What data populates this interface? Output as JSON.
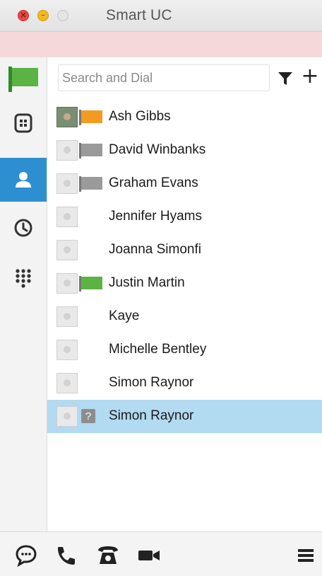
{
  "window": {
    "title": "Smart UC",
    "close_glyph": "×",
    "minimize_glyph": "–"
  },
  "presence": {
    "status_color": "#5bb344",
    "icon": "flag-icon"
  },
  "rail": {
    "items": [
      {
        "id": "directory",
        "icon": "building-icon"
      },
      {
        "id": "contacts",
        "icon": "person-icon",
        "active": true
      },
      {
        "id": "history",
        "icon": "clock-icon"
      },
      {
        "id": "dialpad",
        "icon": "dialpad-icon"
      }
    ],
    "accent_color": "#2e8fd0"
  },
  "search": {
    "placeholder": "Search and Dial",
    "value": "",
    "filter_icon": "filter-icon",
    "add_label": "+"
  },
  "contacts": [
    {
      "name": "Ash Gibbs",
      "avatar": "photo",
      "status": "orange",
      "status_color": "#f39a23"
    },
    {
      "name": "David Winbanks",
      "avatar": "default",
      "status": "gray",
      "status_color": "#9a9a9a"
    },
    {
      "name": "Graham Evans",
      "avatar": "default",
      "status": "gray",
      "status_color": "#9a9a9a"
    },
    {
      "name": "Jennifer Hyams",
      "avatar": "default",
      "status": "none"
    },
    {
      "name": "Joanna Simonfi",
      "avatar": "default",
      "status": "none"
    },
    {
      "name": "Justin Martin",
      "avatar": "default",
      "status": "green",
      "status_color": "#5bb344"
    },
    {
      "name": "Kaye",
      "avatar": "default",
      "status": "none"
    },
    {
      "name": "Michelle Bentley",
      "avatar": "default",
      "status": "none"
    },
    {
      "name": "Simon Raynor",
      "avatar": "default",
      "status": "none"
    },
    {
      "name": "Simon Raynor",
      "avatar": "default",
      "status": "unknown",
      "status_label": "?",
      "selected": true
    }
  ],
  "bottombar": {
    "items": [
      "chat-icon",
      "phone-icon",
      "desk-phone-icon",
      "video-icon",
      "menu-icon"
    ]
  }
}
